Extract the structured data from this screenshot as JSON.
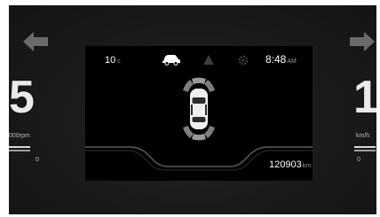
{
  "left_gauge": {
    "gear": "5",
    "rpm_label": "000rpm",
    "zero": "0"
  },
  "right_gauge": {
    "speed": "1",
    "unit": "km/h",
    "zero": "0"
  },
  "display": {
    "temperature": "10",
    "temperature_unit": "c",
    "time": "8:48",
    "time_unit": "AM",
    "odometer": "120903",
    "odometer_unit": "km",
    "status_icons": [
      "car-side-icon",
      "warning-triangle-icon",
      "settings-gear-icon"
    ]
  },
  "parking_sensors": {
    "front_zones_lit": 3,
    "rear_zones_lit": 3
  },
  "colors": {
    "background": "#1a1a1a",
    "display": "#000000",
    "text": "#ffffff",
    "dim": "#8c8c8c"
  }
}
